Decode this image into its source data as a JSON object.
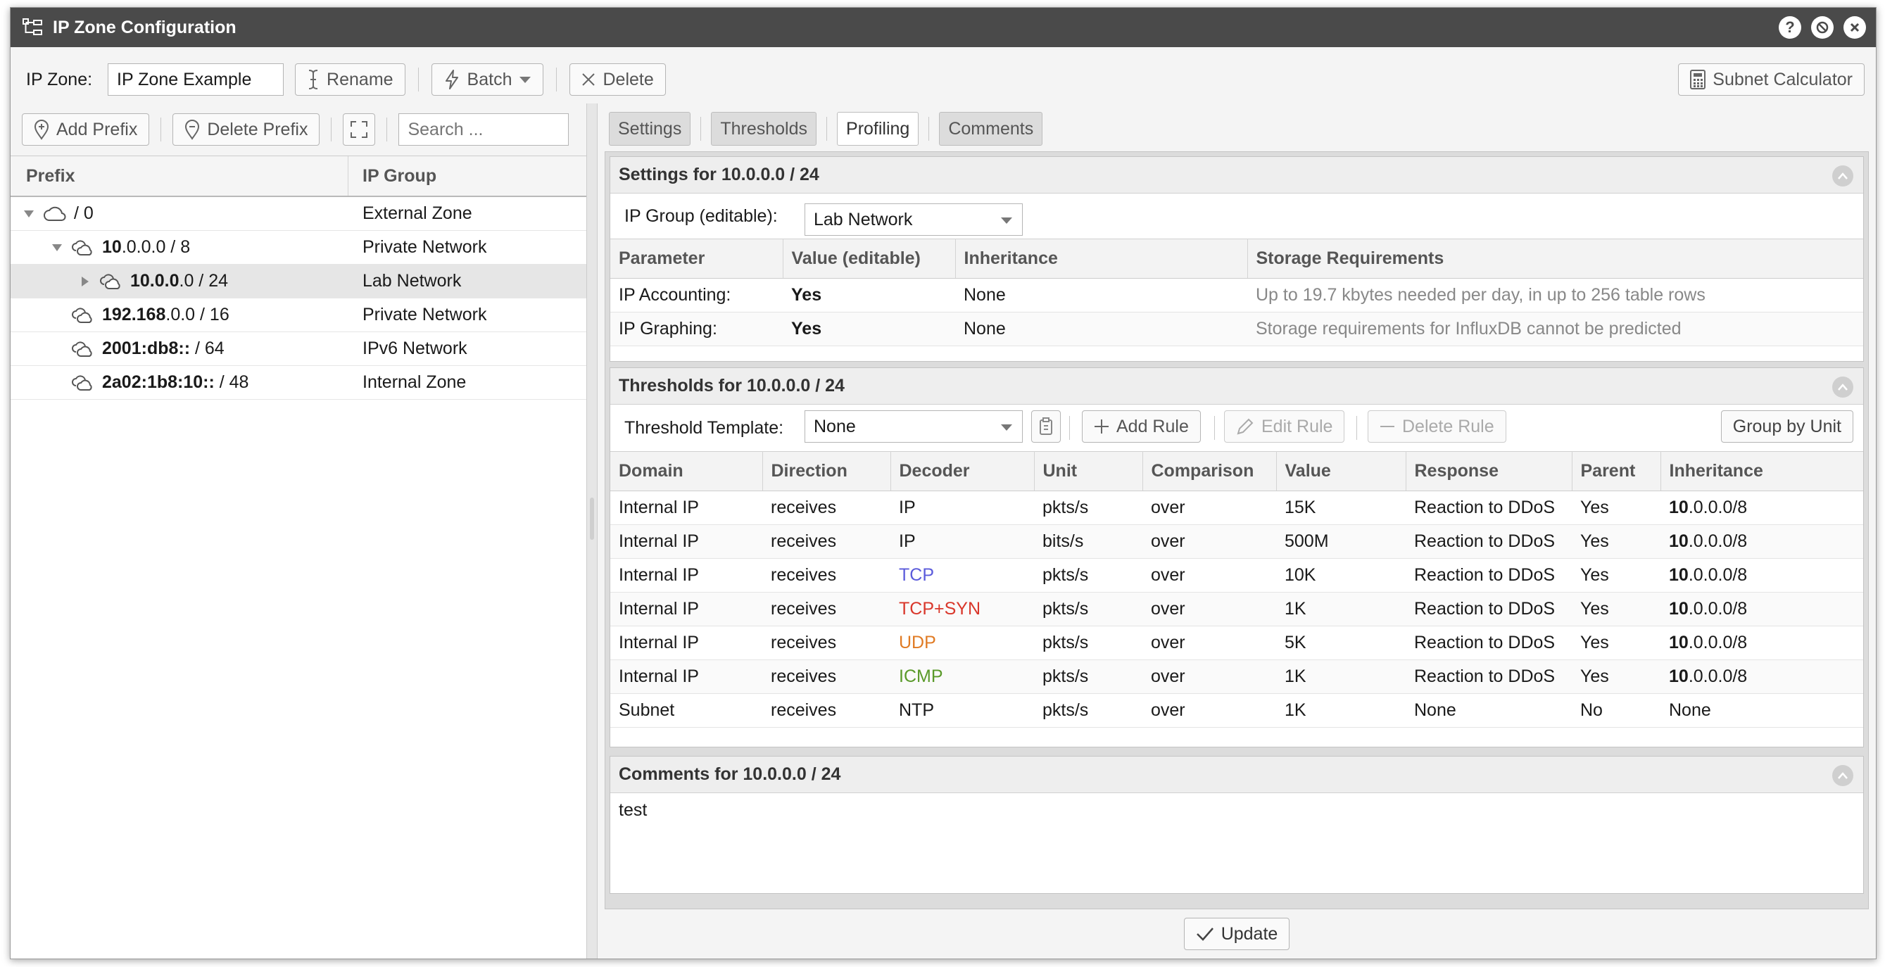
{
  "window": {
    "title": "IP Zone Configuration"
  },
  "topbar": {
    "ip_zone_label": "IP Zone:",
    "ip_zone_value": "IP Zone Example",
    "rename": "Rename",
    "batch": "Batch",
    "delete": "Delete",
    "subnet_calculator": "Subnet Calculator"
  },
  "left_toolbar": {
    "add_prefix": "Add Prefix",
    "delete_prefix": "Delete Prefix",
    "search_placeholder": "Search ..."
  },
  "tree": {
    "headers": [
      "Prefix",
      "IP Group"
    ],
    "rows": [
      {
        "prefix_bold": "",
        "prefix_rest": "/ 0",
        "group": "External Zone",
        "level": 0,
        "toggle": "expanded",
        "icon": "cloud-icon"
      },
      {
        "prefix_bold": "10",
        "prefix_rest": ".0.0.0 / 8",
        "group": "Private Network",
        "level": 1,
        "toggle": "expanded",
        "icon": "multi-cloud-icon"
      },
      {
        "prefix_bold": "10.0.0",
        "prefix_rest": ".0 / 24",
        "group": "Lab Network",
        "level": 2,
        "toggle": "collapsed",
        "icon": "multi-cloud-icon",
        "selected": true
      },
      {
        "prefix_bold": "192.168",
        "prefix_rest": ".0.0 / 16",
        "group": "Private Network",
        "level": 1,
        "toggle": "none",
        "icon": "multi-cloud-icon"
      },
      {
        "prefix_bold": "2001:db8::",
        "prefix_rest": " / 64",
        "group": "IPv6 Network",
        "level": 1,
        "toggle": "none",
        "icon": "multi-cloud-icon"
      },
      {
        "prefix_bold": "2a02:1b8:10::",
        "prefix_rest": " / 48",
        "group": "Internal Zone",
        "level": 1,
        "toggle": "none",
        "icon": "multi-cloud-icon"
      }
    ]
  },
  "tabs": [
    "Settings",
    "Thresholds",
    "Profiling",
    "Comments"
  ],
  "settings": {
    "title": "Settings for 10.0.0.0 / 24",
    "ip_group_label": "IP Group (editable):",
    "ip_group_value": "Lab Network",
    "headers": [
      "Parameter",
      "Value (editable)",
      "Inheritance",
      "Storage Requirements"
    ],
    "rows": [
      {
        "param": "IP Accounting:",
        "value": "Yes",
        "inherit": "None",
        "storage": "Up to 19.7 kbytes needed per day, in up to 256 table rows"
      },
      {
        "param": "IP Graphing:",
        "value": "Yes",
        "inherit": "None",
        "storage": "Storage requirements for InfluxDB cannot be predicted"
      }
    ]
  },
  "thresholds": {
    "title": "Thresholds for 10.0.0.0 / 24",
    "template_label": "Threshold Template:",
    "template_value": "None",
    "add_rule": "Add Rule",
    "edit_rule": "Edit Rule",
    "delete_rule": "Delete Rule",
    "group_by_unit": "Group by Unit",
    "headers": [
      "Domain",
      "Direction",
      "Decoder",
      "Unit",
      "Comparison",
      "Value",
      "Response",
      "Parent",
      "Inheritance"
    ],
    "rows": [
      {
        "domain": "Internal IP",
        "direction": "receives",
        "decoder": "IP",
        "decoder_color": "#1a1a1a",
        "unit": "pkts/s",
        "comparison": "over",
        "value": "15K",
        "response": "Reaction to DDoS",
        "parent": "Yes",
        "inherit_bold": "10",
        "inherit_rest": ".0.0.0/8"
      },
      {
        "domain": "Internal IP",
        "direction": "receives",
        "decoder": "IP",
        "decoder_color": "#1a1a1a",
        "unit": "bits/s",
        "comparison": "over",
        "value": "500M",
        "response": "Reaction to DDoS",
        "parent": "Yes",
        "inherit_bold": "10",
        "inherit_rest": ".0.0.0/8"
      },
      {
        "domain": "Internal IP",
        "direction": "receives",
        "decoder": "TCP",
        "decoder_color": "#5b5bdb",
        "unit": "pkts/s",
        "comparison": "over",
        "value": "10K",
        "response": "Reaction to DDoS",
        "parent": "Yes",
        "inherit_bold": "10",
        "inherit_rest": ".0.0.0/8"
      },
      {
        "domain": "Internal IP",
        "direction": "receives",
        "decoder": "TCP+SYN",
        "decoder_color": "#d9372b",
        "unit": "pkts/s",
        "comparison": "over",
        "value": "1K",
        "response": "Reaction to DDoS",
        "parent": "Yes",
        "inherit_bold": "10",
        "inherit_rest": ".0.0.0/8"
      },
      {
        "domain": "Internal IP",
        "direction": "receives",
        "decoder": "UDP",
        "decoder_color": "#e07b24",
        "unit": "pkts/s",
        "comparison": "over",
        "value": "5K",
        "response": "Reaction to DDoS",
        "parent": "Yes",
        "inherit_bold": "10",
        "inherit_rest": ".0.0.0/8"
      },
      {
        "domain": "Internal IP",
        "direction": "receives",
        "decoder": "ICMP",
        "decoder_color": "#5a9a2a",
        "unit": "pkts/s",
        "comparison": "over",
        "value": "1K",
        "response": "Reaction to DDoS",
        "parent": "Yes",
        "inherit_bold": "10",
        "inherit_rest": ".0.0.0/8"
      },
      {
        "domain": "Subnet",
        "direction": "receives",
        "decoder": "NTP",
        "decoder_color": "#1a1a1a",
        "unit": "pkts/s",
        "comparison": "over",
        "value": "1K",
        "response": "None",
        "parent": "No",
        "inherit_bold": "",
        "inherit_rest": "None"
      }
    ]
  },
  "comments": {
    "title": "Comments for 10.0.0.0 / 24",
    "text": "test"
  },
  "footer": {
    "update": "Update"
  }
}
